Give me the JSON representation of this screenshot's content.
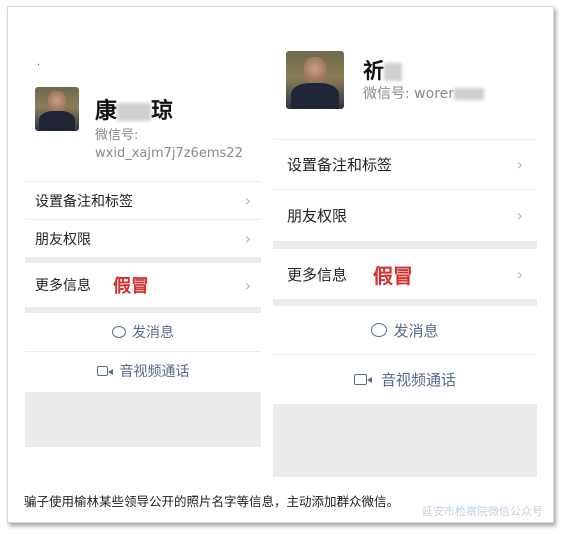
{
  "left": {
    "dot": ".",
    "nickname_visible": "康",
    "nickname_tail": "琼",
    "wechat_id_label": "微信号:",
    "wechat_id": "wxid_xajm7j7z6ems22",
    "menu": {
      "remark_tags": "设置备注和标签",
      "friend_permissions": "朋友权限",
      "more_info": "更多信息"
    },
    "fake_label": "假冒",
    "send_message": "发消息",
    "video_call": "音视频通话"
  },
  "right": {
    "nickname_visible": "祈",
    "wechat_id_label": "微信号:",
    "wechat_id": "worer",
    "menu": {
      "remark_tags": "设置备注和标签",
      "friend_permissions": "朋友权限",
      "more_info": "更多信息"
    },
    "fake_label": "假冒",
    "send_message": "发消息",
    "video_call": "音视频通话"
  },
  "caption": "骗子使用榆林某些领导公开的照片名字等信息，主动添加群众微信。",
  "watermark": "延安市检察院微信公众号",
  "colors": {
    "fake_red": "#d4302f",
    "action_blue": "#556a8f",
    "divider_grey": "#ebebeb"
  },
  "icons": {
    "chevron": "chevron-right-icon",
    "message": "chat-bubble-icon",
    "video": "video-camera-icon"
  }
}
